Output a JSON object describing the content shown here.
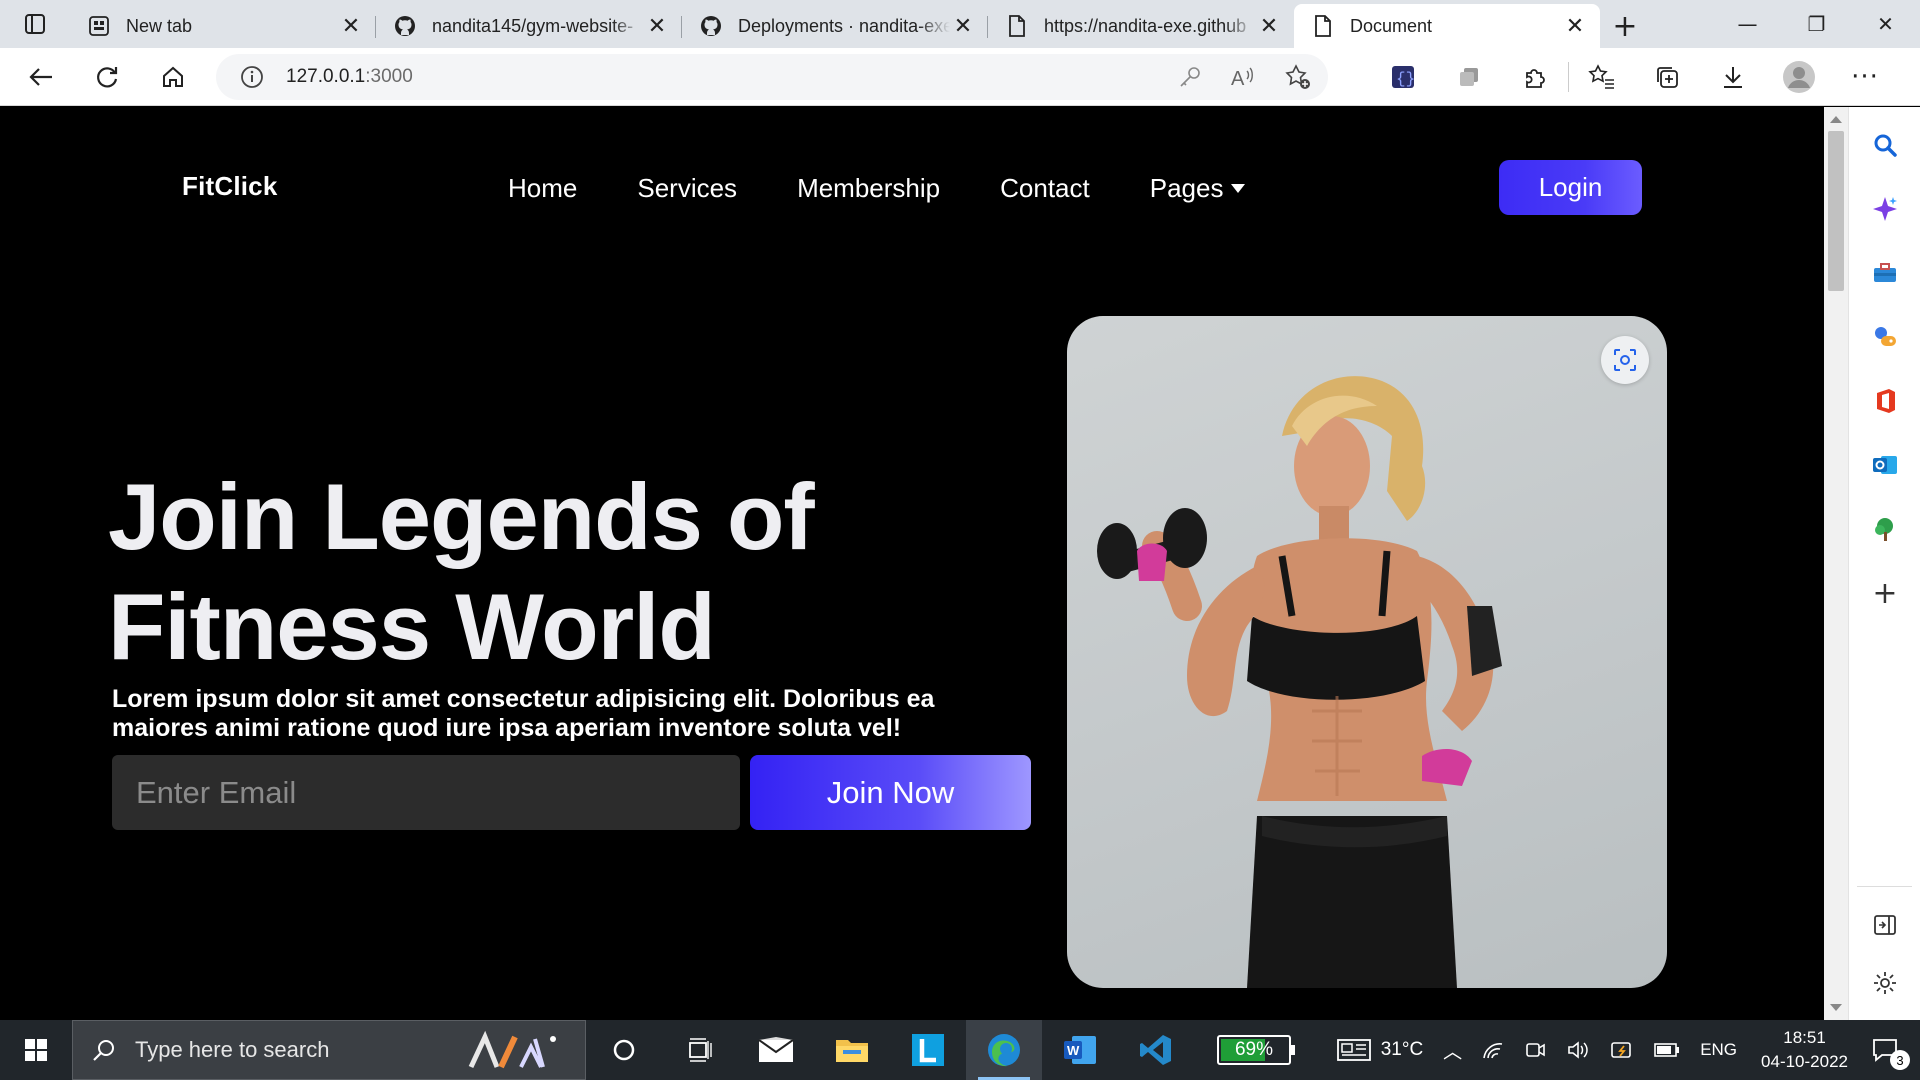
{
  "browser": {
    "tabs": [
      {
        "title": "New tab",
        "icon": "new-tab-page-icon"
      },
      {
        "title": "nandita145/gym-website-",
        "icon": "github-icon"
      },
      {
        "title": "Deployments · nandita-exe",
        "icon": "github-icon"
      },
      {
        "title": "https://nandita-exe.github",
        "icon": "page-icon"
      },
      {
        "title": "Document",
        "icon": "page-icon",
        "active": true
      }
    ],
    "address": {
      "host": "127.0.0.1",
      "port": ":3000"
    }
  },
  "page": {
    "logo": "FitClick",
    "nav": [
      "Home",
      "Services",
      "Membership",
      "Contact",
      "Pages"
    ],
    "login_label": "Login",
    "hero": {
      "title_line1": "Join Legends of",
      "title_line2": "Fitness World",
      "description": "Lorem ipsum dolor sit amet consectetur adipisicing elit. Doloribus ea maiores animi ratione quod iure ipsa aperiam inventore soluta vel!",
      "email_placeholder": "Enter Email",
      "join_label": "Join Now"
    },
    "colors": {
      "accent": "#3d2cf5",
      "accent_light": "#9e97ff",
      "background": "#000000"
    }
  },
  "taskbar": {
    "search_placeholder": "Type here to search",
    "battery": "69%",
    "battery_level": 0.69,
    "weather": "31°C",
    "language": "ENG",
    "time": "18:51",
    "date": "04-10-2022",
    "notifications": "3"
  }
}
